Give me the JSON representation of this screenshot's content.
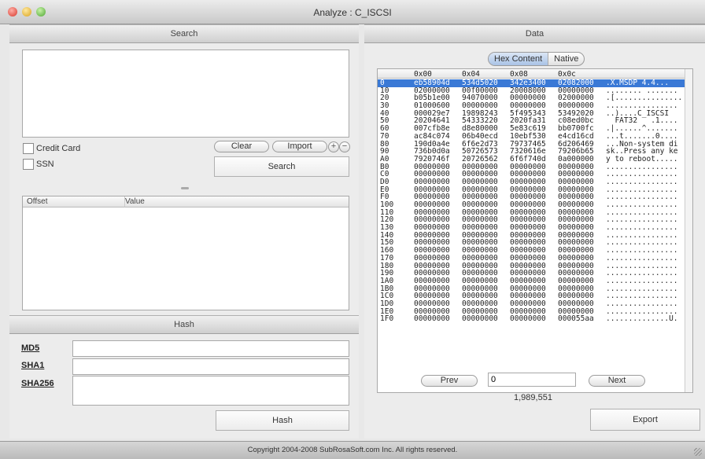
{
  "window": {
    "title": "Analyze : C_ISCSI"
  },
  "search": {
    "header": "Search",
    "options": [
      {
        "label": "Credit Card",
        "checked": false
      },
      {
        "label": "SSN",
        "checked": false
      }
    ],
    "clear_label": "Clear",
    "import_label": "Import",
    "plus_label": "+",
    "minus_label": "−",
    "search_label": "Search",
    "results_columns": [
      "Offset",
      "Value"
    ]
  },
  "hash": {
    "header": "Hash",
    "fields": [
      {
        "label": "MD5",
        "value": ""
      },
      {
        "label": "SHA1",
        "value": ""
      },
      {
        "label": "SHA256",
        "value": ""
      }
    ],
    "button_label": "Hash"
  },
  "data": {
    "header": "Data",
    "tabs": [
      {
        "label": "Hex Content",
        "active": true
      },
      {
        "label": "Native",
        "active": false
      }
    ],
    "columns": [
      "0x00",
      "0x04",
      "0x08",
      "0x0c"
    ],
    "rows": [
      [
        "0",
        "eb58904d",
        "534d5020",
        "342e3400",
        "02082000",
        ".X.MSDP 4.4..."
      ],
      [
        "10",
        "02000000",
        "00f00000",
        "20008000",
        "00000000",
        "........ ......."
      ],
      [
        "20",
        "b05b1e00",
        "94070000",
        "00000000",
        "02000000",
        ".[..............."
      ],
      [
        "30",
        "01000600",
        "00000000",
        "00000000",
        "00000000",
        "................"
      ],
      [
        "40",
        "000029e7",
        "19898243",
        "5f495343",
        "53492020",
        "..)....C_ISCSI  "
      ],
      [
        "50",
        "20204641",
        "54333220",
        "2020fa31",
        "c08ed0bc",
        "  FAT32   .1...."
      ],
      [
        "60",
        "007cfb8e",
        "d8e80000",
        "5e83c619",
        "bb0700fc",
        ".|......^......."
      ],
      [
        "70",
        "ac84c074",
        "06b40ecd",
        "10ebf530",
        "e4cd16cd",
        "...t.......0...."
      ],
      [
        "80",
        "190d0a4e",
        "6f6e2d73",
        "79737465",
        "6d206469",
        "...Non-system di"
      ],
      [
        "90",
        "736b0d0a",
        "50726573",
        "7320616e",
        "79206b65",
        "sk..Press any ke"
      ],
      [
        "A0",
        "7920746f",
        "20726562",
        "6f6f740d",
        "0a000000",
        "y to reboot....."
      ],
      [
        "B0",
        "00000000",
        "00000000",
        "00000000",
        "00000000",
        "................"
      ],
      [
        "C0",
        "00000000",
        "00000000",
        "00000000",
        "00000000",
        "................"
      ],
      [
        "D0",
        "00000000",
        "00000000",
        "00000000",
        "00000000",
        "................"
      ],
      [
        "E0",
        "00000000",
        "00000000",
        "00000000",
        "00000000",
        "................"
      ],
      [
        "F0",
        "00000000",
        "00000000",
        "00000000",
        "00000000",
        "................"
      ],
      [
        "100",
        "00000000",
        "00000000",
        "00000000",
        "00000000",
        "................"
      ],
      [
        "110",
        "00000000",
        "00000000",
        "00000000",
        "00000000",
        "................"
      ],
      [
        "120",
        "00000000",
        "00000000",
        "00000000",
        "00000000",
        "................"
      ],
      [
        "130",
        "00000000",
        "00000000",
        "00000000",
        "00000000",
        "................"
      ],
      [
        "140",
        "00000000",
        "00000000",
        "00000000",
        "00000000",
        "................"
      ],
      [
        "150",
        "00000000",
        "00000000",
        "00000000",
        "00000000",
        "................"
      ],
      [
        "160",
        "00000000",
        "00000000",
        "00000000",
        "00000000",
        "................"
      ],
      [
        "170",
        "00000000",
        "00000000",
        "00000000",
        "00000000",
        "................"
      ],
      [
        "180",
        "00000000",
        "00000000",
        "00000000",
        "00000000",
        "................"
      ],
      [
        "190",
        "00000000",
        "00000000",
        "00000000",
        "00000000",
        "................"
      ],
      [
        "1A0",
        "00000000",
        "00000000",
        "00000000",
        "00000000",
        "................"
      ],
      [
        "1B0",
        "00000000",
        "00000000",
        "00000000",
        "00000000",
        "................"
      ],
      [
        "1C0",
        "00000000",
        "00000000",
        "00000000",
        "00000000",
        "................"
      ],
      [
        "1D0",
        "00000000",
        "00000000",
        "00000000",
        "00000000",
        "................"
      ],
      [
        "1E0",
        "00000000",
        "00000000",
        "00000000",
        "00000000",
        "................"
      ],
      [
        "1F0",
        "00000000",
        "00000000",
        "00000000",
        "000055aa",
        "..............U."
      ]
    ],
    "prev_label": "Prev",
    "next_label": "Next",
    "page_value": "0",
    "total": "1,989,551",
    "export_label": "Export"
  },
  "footer": {
    "copyright": "Copyright 2004-2008 SubRosaSoft.com Inc. All rights reserved."
  }
}
